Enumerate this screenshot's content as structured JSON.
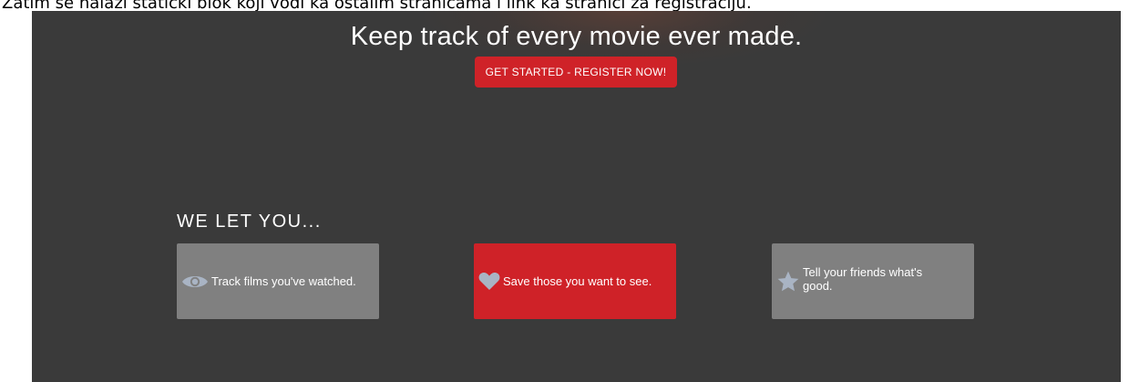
{
  "caption": "Zatim se nalazi statički blok koji vodi ka ostalim stranicama i link ka stranici za registraciju.",
  "hero": {
    "headline": "Keep track of every movie ever made.",
    "cta_label": "GET STARTED - REGISTER NOW!"
  },
  "features_section": {
    "heading": "WE LET YOU...",
    "items": [
      {
        "icon": "eye-icon",
        "label": "Track films you've watched."
      },
      {
        "icon": "heart-icon",
        "label": "Save those you want to see."
      },
      {
        "icon": "star-icon",
        "label": "Tell your friends what's good."
      }
    ]
  },
  "colors": {
    "background": "#3a3a3a",
    "accent": "#cf2228",
    "card_gray": "#808080",
    "icon": "#a9b4c4"
  }
}
